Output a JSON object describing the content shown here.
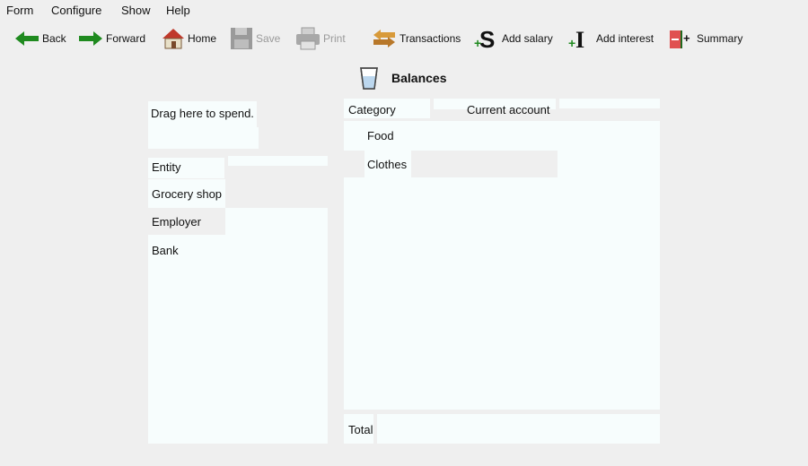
{
  "menu": {
    "form": "Form",
    "configure": "Configure",
    "show": "Show",
    "help": "Help"
  },
  "toolbar": {
    "back": "Back",
    "forward": "Forward",
    "home": "Home",
    "save": "Save",
    "print": "Print",
    "transactions": "Transactions",
    "add_salary": "Add salary",
    "add_interest": "Add interest",
    "summary": "Summary"
  },
  "page": {
    "title": "Balances",
    "title_icon": "cup-icon"
  },
  "spend": {
    "label": "Drag here to spend."
  },
  "entities": {
    "header": "Entity",
    "items": [
      "Grocery shop",
      "Employer",
      "Bank"
    ]
  },
  "balances": {
    "category_header": "Category",
    "account_header": "Current account",
    "rows": [
      "Food",
      "Clothes"
    ],
    "total_label": "Total"
  },
  "colors": {
    "arrow_green": "#1f8a1f",
    "home_roof": "#c0392b",
    "summary_red": "#e05050",
    "panel_bg": "#f7fdfd",
    "window_bg": "#efefef"
  }
}
